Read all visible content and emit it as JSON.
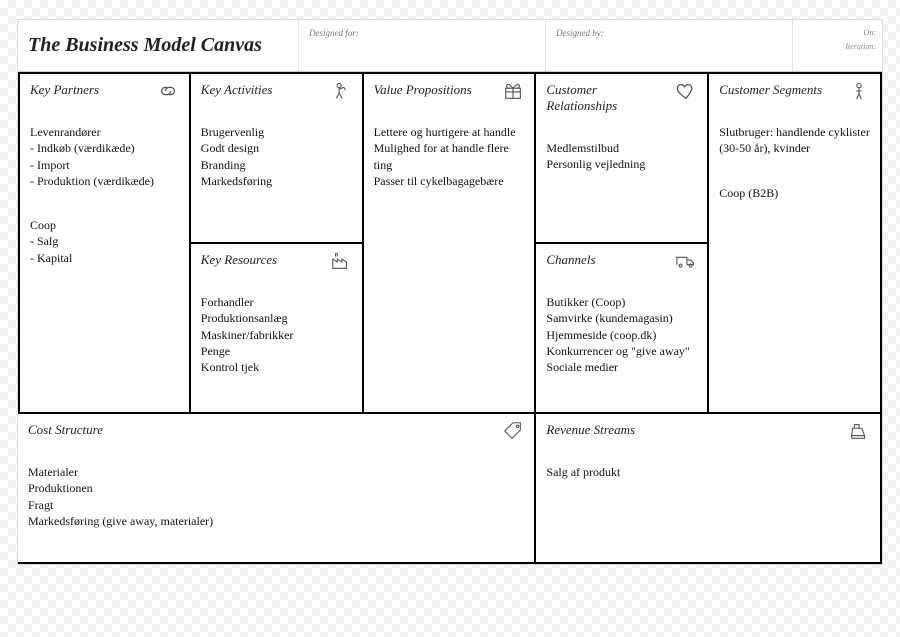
{
  "header": {
    "title": "The Business Model Canvas",
    "designed_for_label": "Designed for:",
    "designed_by_label": "Designed by:",
    "on_label": "On:",
    "iteration_label": "Iteration:"
  },
  "cells": {
    "key_partners": {
      "title": "Key Partners",
      "groups": [
        "Levenrandører\n- Indkøb (værdikæde)\n- Import\n- Produktion (værdikæde)",
        "Coop\n- Salg\n- Kapital"
      ]
    },
    "key_activities": {
      "title": "Key Activities",
      "groups": [
        "Brugervenlig\nGodt design\nBranding\nMarkedsføring"
      ]
    },
    "key_resources": {
      "title": "Key Resources",
      "groups": [
        "Forhandler\nProduktionsanlæg\nMaskiner/fabrikker\nPenge\nKontrol tjek"
      ]
    },
    "value_propositions": {
      "title": "Value Propositions",
      "groups": [
        "Lettere og hurtigere at handle\nMulighed for at handle flere ting\nPasser til cykelbagagebære"
      ]
    },
    "customer_relationships": {
      "title": "Customer Relationships",
      "groups": [
        "Medlemstilbud\nPersonlig vejledning"
      ]
    },
    "channels": {
      "title": "Channels",
      "groups": [
        "Butikker (Coop)\nSamvirke (kundemagasin)\nHjemmeside (coop.dk)\nKonkurrencer og \"give away\"\nSociale medier"
      ]
    },
    "customer_segments": {
      "title": "Customer Segments",
      "groups": [
        "Slutbruger: handlende cyklister (30-50 år), kvinder",
        "Coop (B2B)"
      ]
    },
    "cost_structure": {
      "title": "Cost Structure",
      "groups": [
        "Materialer\nProduktionen\nFragt\nMarkedsføring (give away, materialer)"
      ]
    },
    "revenue_streams": {
      "title": "Revenue Streams",
      "groups": [
        "Salg af produkt"
      ]
    }
  }
}
